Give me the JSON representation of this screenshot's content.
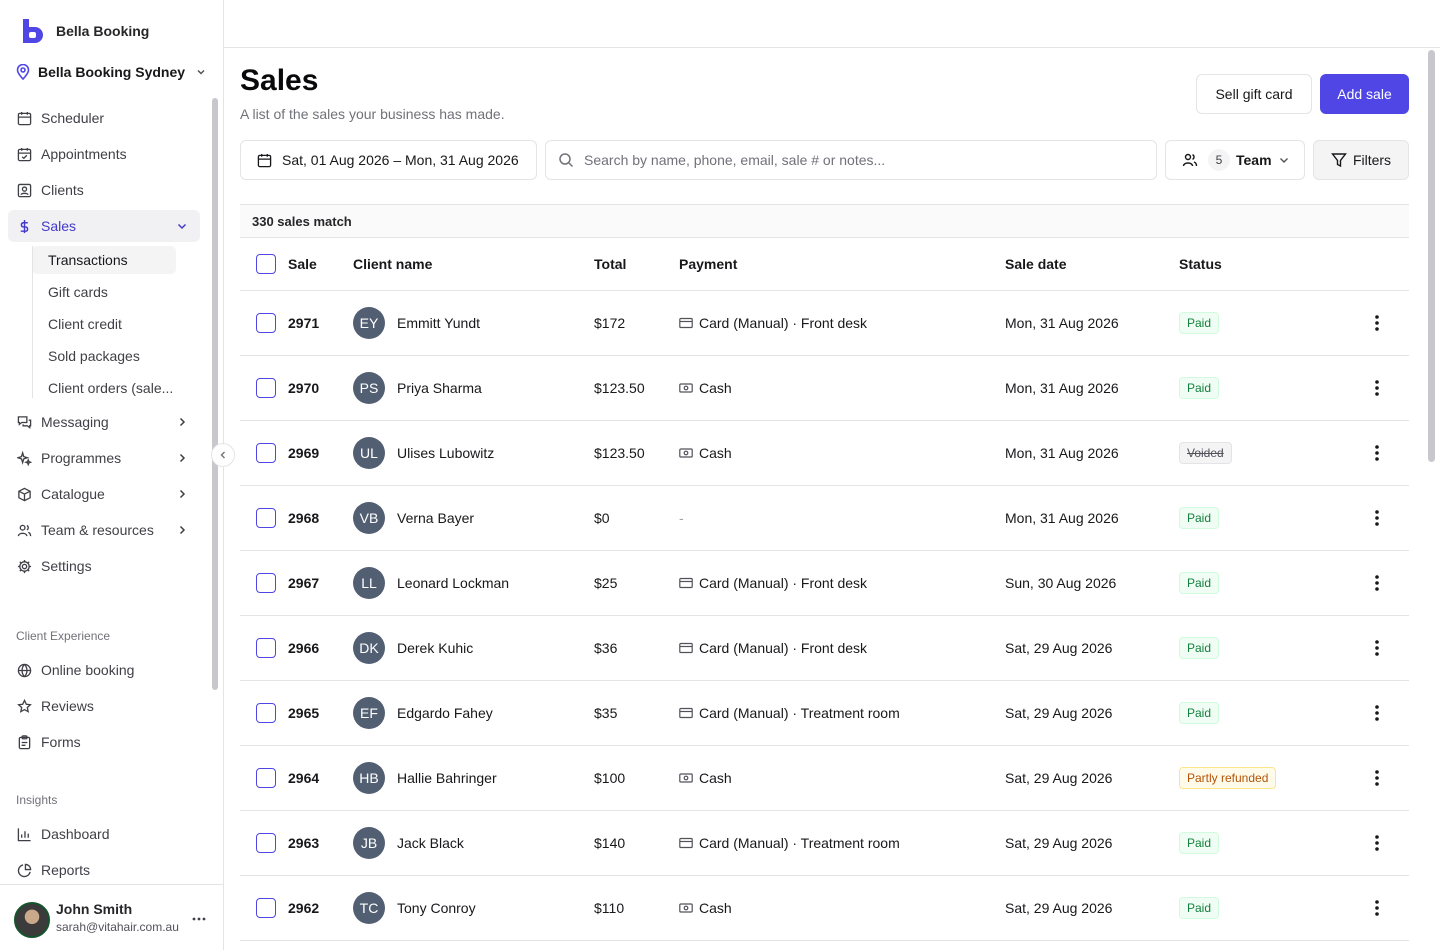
{
  "brand": {
    "name": "Bella Booking"
  },
  "location": {
    "name": "Bella Booking Sydney"
  },
  "nav": {
    "scheduler": "Scheduler",
    "appointments": "Appointments",
    "clients": "Clients",
    "sales": "Sales",
    "sales_sub": [
      "Transactions",
      "Gift cards",
      "Client credit",
      "Sold packages",
      "Client orders (sale..."
    ],
    "messaging": "Messaging",
    "programmes": "Programmes",
    "catalogue": "Catalogue",
    "team_resources": "Team & resources",
    "settings": "Settings",
    "section_client_experience": "Client Experience",
    "online_booking": "Online booking",
    "reviews": "Reviews",
    "forms": "Forms",
    "section_insights": "Insights",
    "dashboard": "Dashboard",
    "reports": "Reports"
  },
  "user": {
    "name": "John Smith",
    "email": "sarah@vitahair.com.au"
  },
  "page": {
    "title": "Sales",
    "subtitle": "A list of the sales your business has made.",
    "sell_gift_card": "Sell gift card",
    "add_sale": "Add sale"
  },
  "toolbar": {
    "date_range": "Sat, 01 Aug 2026 – Mon, 31 Aug 2026",
    "search_placeholder": "Search by name, phone, email, sale # or notes...",
    "team_count": "5",
    "team_label": "Team",
    "filters": "Filters"
  },
  "table": {
    "match_text": "330 sales match",
    "columns": {
      "sale": "Sale",
      "client": "Client name",
      "total": "Total",
      "payment": "Payment",
      "date": "Sale date",
      "status": "Status"
    },
    "rows": [
      {
        "sale": "2971",
        "initials": "EY",
        "client": "Emmitt Yundt",
        "total": "$172",
        "payment": "Card (Manual) · Front desk",
        "payment_icon": "card-icon",
        "date": "Mon, 31 Aug 2026",
        "status": "Paid",
        "status_type": "paid"
      },
      {
        "sale": "2970",
        "initials": "PS",
        "client": "Priya Sharma",
        "total": "$123.50",
        "payment": "Cash",
        "payment_icon": "cash-icon",
        "date": "Mon, 31 Aug 2026",
        "status": "Paid",
        "status_type": "paid"
      },
      {
        "sale": "2969",
        "initials": "UL",
        "client": "Ulises Lubowitz",
        "total": "$123.50",
        "payment": "Cash",
        "payment_icon": "cash-icon",
        "date": "Mon, 31 Aug 2026",
        "status": "Voided",
        "status_type": "voided"
      },
      {
        "sale": "2968",
        "initials": "VB",
        "client": "Verna Bayer",
        "total": "$0",
        "payment": "-",
        "payment_icon": "",
        "date": "Mon, 31 Aug 2026",
        "status": "Paid",
        "status_type": "paid"
      },
      {
        "sale": "2967",
        "initials": "LL",
        "client": "Leonard Lockman",
        "total": "$25",
        "payment": "Card (Manual) · Front desk",
        "payment_icon": "card-icon",
        "date": "Sun, 30 Aug 2026",
        "status": "Paid",
        "status_type": "paid"
      },
      {
        "sale": "2966",
        "initials": "DK",
        "client": "Derek Kuhic",
        "total": "$36",
        "payment": "Card (Manual) · Front desk",
        "payment_icon": "card-icon",
        "date": "Sat, 29 Aug 2026",
        "status": "Paid",
        "status_type": "paid"
      },
      {
        "sale": "2965",
        "initials": "EF",
        "client": "Edgardo Fahey",
        "total": "$35",
        "payment": "Card (Manual) · Treatment room",
        "payment_icon": "card-icon",
        "date": "Sat, 29 Aug 2026",
        "status": "Paid",
        "status_type": "paid"
      },
      {
        "sale": "2964",
        "initials": "HB",
        "client": "Hallie Bahringer",
        "total": "$100",
        "payment": "Cash",
        "payment_icon": "cash-icon",
        "date": "Sat, 29 Aug 2026",
        "status": "Partly refunded",
        "status_type": "partial"
      },
      {
        "sale": "2963",
        "initials": "JB",
        "client": "Jack Black",
        "total": "$140",
        "payment": "Card (Manual) · Treatment room",
        "payment_icon": "card-icon",
        "date": "Sat, 29 Aug 2026",
        "status": "Paid",
        "status_type": "paid"
      },
      {
        "sale": "2962",
        "initials": "TC",
        "client": "Tony Conroy",
        "total": "$110",
        "payment": "Cash",
        "payment_icon": "cash-icon",
        "date": "Sat, 29 Aug 2026",
        "status": "Paid",
        "status_type": "paid"
      }
    ]
  },
  "colors": {
    "accent": "#4f46e5",
    "avatar_bg": "#525f73",
    "paid": "#15803d",
    "partial": "#b45309"
  }
}
